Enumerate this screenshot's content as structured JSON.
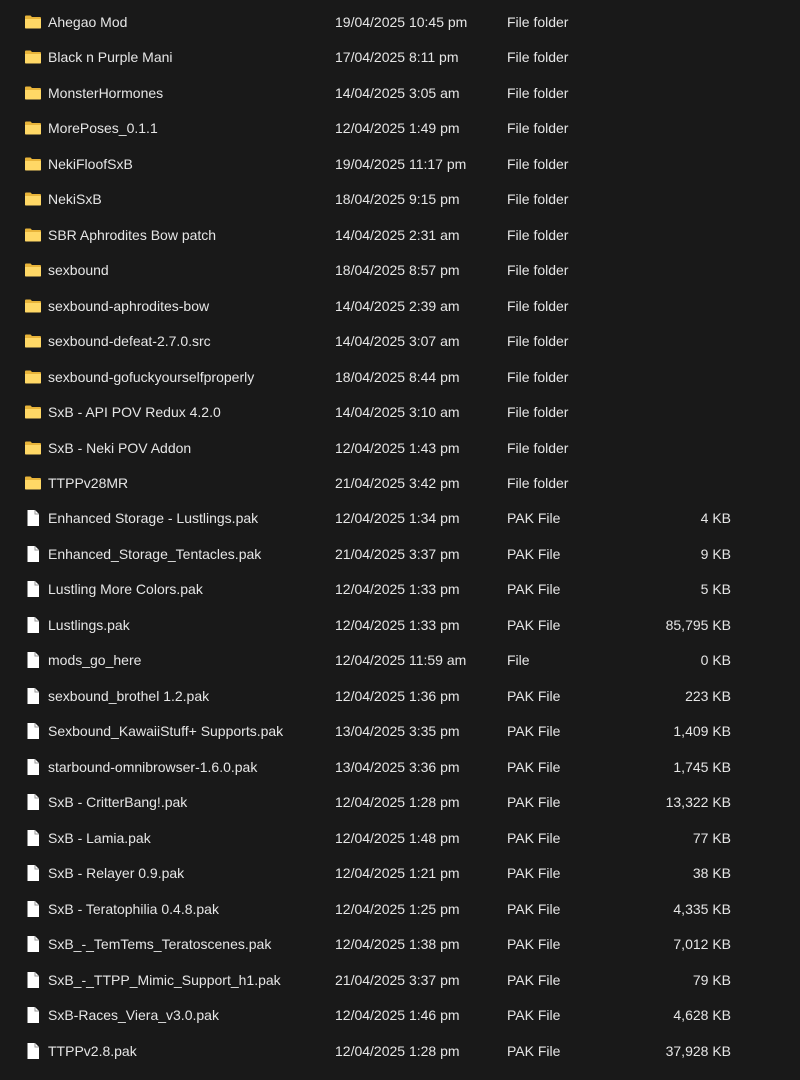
{
  "colors": {
    "background": "#191919",
    "text": "#e6e6e6",
    "folder_back": "#e8b43a",
    "folder_front": "#ffd866",
    "file_body": "#ffffff"
  },
  "items": [
    {
      "name": "Ahegao Mod",
      "date": "19/04/2025 10:45 pm",
      "type": "File folder",
      "size": "",
      "icon": "folder-icon"
    },
    {
      "name": "Black n Purple Mani",
      "date": "17/04/2025 8:11 pm",
      "type": "File folder",
      "size": "",
      "icon": "folder-icon"
    },
    {
      "name": "MonsterHormones",
      "date": "14/04/2025 3:05 am",
      "type": "File folder",
      "size": "",
      "icon": "folder-icon"
    },
    {
      "name": "MorePoses_0.1.1",
      "date": "12/04/2025 1:49 pm",
      "type": "File folder",
      "size": "",
      "icon": "folder-icon"
    },
    {
      "name": "NekiFloofSxB",
      "date": "19/04/2025 11:17 pm",
      "type": "File folder",
      "size": "",
      "icon": "folder-icon"
    },
    {
      "name": "NekiSxB",
      "date": "18/04/2025 9:15 pm",
      "type": "File folder",
      "size": "",
      "icon": "folder-icon"
    },
    {
      "name": "SBR Aphrodites Bow patch",
      "date": "14/04/2025 2:31 am",
      "type": "File folder",
      "size": "",
      "icon": "folder-icon"
    },
    {
      "name": "sexbound",
      "date": "18/04/2025 8:57 pm",
      "type": "File folder",
      "size": "",
      "icon": "folder-icon"
    },
    {
      "name": "sexbound-aphrodites-bow",
      "date": "14/04/2025 2:39 am",
      "type": "File folder",
      "size": "",
      "icon": "folder-icon"
    },
    {
      "name": "sexbound-defeat-2.7.0.src",
      "date": "14/04/2025 3:07 am",
      "type": "File folder",
      "size": "",
      "icon": "folder-icon"
    },
    {
      "name": "sexbound-gofuckyourselfproperly",
      "date": "18/04/2025 8:44 pm",
      "type": "File folder",
      "size": "",
      "icon": "folder-icon"
    },
    {
      "name": "SxB - API POV Redux 4.2.0",
      "date": "14/04/2025 3:10 am",
      "type": "File folder",
      "size": "",
      "icon": "folder-icon"
    },
    {
      "name": "SxB - Neki POV Addon",
      "date": "12/04/2025 1:43 pm",
      "type": "File folder",
      "size": "",
      "icon": "folder-icon"
    },
    {
      "name": "TTPPv28MR",
      "date": "21/04/2025 3:42 pm",
      "type": "File folder",
      "size": "",
      "icon": "folder-icon"
    },
    {
      "name": "Enhanced Storage - Lustlings.pak",
      "date": "12/04/2025 1:34 pm",
      "type": "PAK File",
      "size": "4 KB",
      "icon": "file-icon"
    },
    {
      "name": "Enhanced_Storage_Tentacles.pak",
      "date": "21/04/2025 3:37 pm",
      "type": "PAK File",
      "size": "9 KB",
      "icon": "file-icon"
    },
    {
      "name": "Lustling More Colors.pak",
      "date": "12/04/2025 1:33 pm",
      "type": "PAK File",
      "size": "5 KB",
      "icon": "file-icon"
    },
    {
      "name": "Lustlings.pak",
      "date": "12/04/2025 1:33 pm",
      "type": "PAK File",
      "size": "85,795 KB",
      "icon": "file-icon"
    },
    {
      "name": "mods_go_here",
      "date": "12/04/2025 11:59 am",
      "type": "File",
      "size": "0 KB",
      "icon": "file-icon"
    },
    {
      "name": "sexbound_brothel 1.2.pak",
      "date": "12/04/2025 1:36 pm",
      "type": "PAK File",
      "size": "223 KB",
      "icon": "file-icon"
    },
    {
      "name": "Sexbound_KawaiiStuff+ Supports.pak",
      "date": "13/04/2025 3:35 pm",
      "type": "PAK File",
      "size": "1,409 KB",
      "icon": "file-icon"
    },
    {
      "name": "starbound-omnibrowser-1.6.0.pak",
      "date": "13/04/2025 3:36 pm",
      "type": "PAK File",
      "size": "1,745 KB",
      "icon": "file-icon"
    },
    {
      "name": "SxB - CritterBang!.pak",
      "date": "12/04/2025 1:28 pm",
      "type": "PAK File",
      "size": "13,322 KB",
      "icon": "file-icon"
    },
    {
      "name": "SxB - Lamia.pak",
      "date": "12/04/2025 1:48 pm",
      "type": "PAK File",
      "size": "77 KB",
      "icon": "file-icon"
    },
    {
      "name": "SxB - Relayer 0.9.pak",
      "date": "12/04/2025 1:21 pm",
      "type": "PAK File",
      "size": "38 KB",
      "icon": "file-icon"
    },
    {
      "name": "SxB - Teratophilia 0.4.8.pak",
      "date": "12/04/2025 1:25 pm",
      "type": "PAK File",
      "size": "4,335 KB",
      "icon": "file-icon"
    },
    {
      "name": "SxB_-_TemTems_Teratoscenes.pak",
      "date": "12/04/2025 1:38 pm",
      "type": "PAK File",
      "size": "7,012 KB",
      "icon": "file-icon"
    },
    {
      "name": "SxB_-_TTPP_Mimic_Support_h1.pak",
      "date": "21/04/2025 3:37 pm",
      "type": "PAK File",
      "size": "79 KB",
      "icon": "file-icon"
    },
    {
      "name": "SxB-Races_Viera_v3.0.pak",
      "date": "12/04/2025 1:46 pm",
      "type": "PAK File",
      "size": "4,628 KB",
      "icon": "file-icon"
    },
    {
      "name": "TTPPv2.8.pak",
      "date": "12/04/2025 1:28 pm",
      "type": "PAK File",
      "size": "37,928 KB",
      "icon": "file-icon"
    }
  ]
}
